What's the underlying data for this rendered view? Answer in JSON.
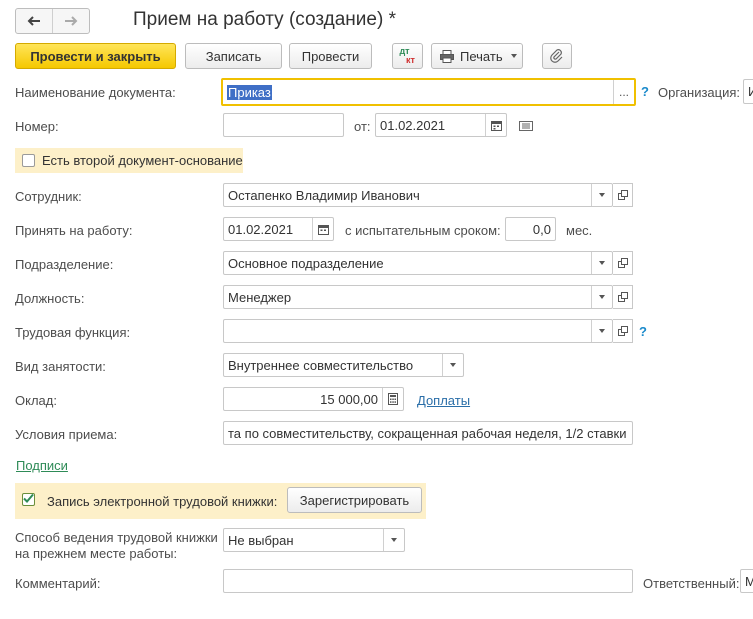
{
  "header": {
    "title": "Прием на работу (создание) *"
  },
  "toolbar": {
    "post_close": "Провести и закрыть",
    "save": "Записать",
    "post": "Провести",
    "dtkt_top": "дт",
    "dtkt_bottom": "кт",
    "print": "Печать"
  },
  "form": {
    "doc_name_label": "Наименование документа:",
    "doc_name_value": "Приказ",
    "org_label": "Организация:",
    "org_value": "И",
    "number_label": "Номер:",
    "number_value": "",
    "from_label": "от:",
    "date_value": "01.02.2021",
    "second_doc_label": "Есть второй документ-основание",
    "employee_label": "Сотрудник:",
    "employee_value": "Остапенко Владимир Иванович",
    "hire_label": "Принять на работу:",
    "hire_date": "01.02.2021",
    "trial_label": "с испытательным сроком:",
    "trial_value": "0,0",
    "trial_unit": "мес.",
    "division_label": "Подразделение:",
    "division_value": "Основное подразделение",
    "position_label": "Должность:",
    "position_value": "Менеджер",
    "labor_func_label": "Трудовая функция:",
    "labor_func_value": "",
    "employment_label": "Вид занятости:",
    "employment_value": "Внутреннее совместительство",
    "salary_label": "Оклад:",
    "salary_value": "15 000,00",
    "surcharges_link": "Доплаты",
    "conditions_label": "Условия приема:",
    "conditions_value": "та по совместительству, сокращенная рабочая неделя, 1/2 ставки",
    "signatures_link": "Подписи",
    "ework_label": "Запись электронной трудовой книжки:",
    "register_button": "Зарегистрировать",
    "book_method_label_1": "Способ ведения трудовой книжки",
    "book_method_label_2": "на прежнем месте работы:",
    "book_method_value": "Не выбран",
    "comment_label": "Комментарий:",
    "comment_value": "",
    "responsible_label": "Ответственный:",
    "responsible_value": "М",
    "help": "?",
    "ellipsis": "..."
  },
  "colors": {
    "primary_button": "#f5c800",
    "focus_border": "#f0c000",
    "link": "#2a6ea8",
    "help": "#1b8acb",
    "highlight": "#fdf0c9"
  }
}
